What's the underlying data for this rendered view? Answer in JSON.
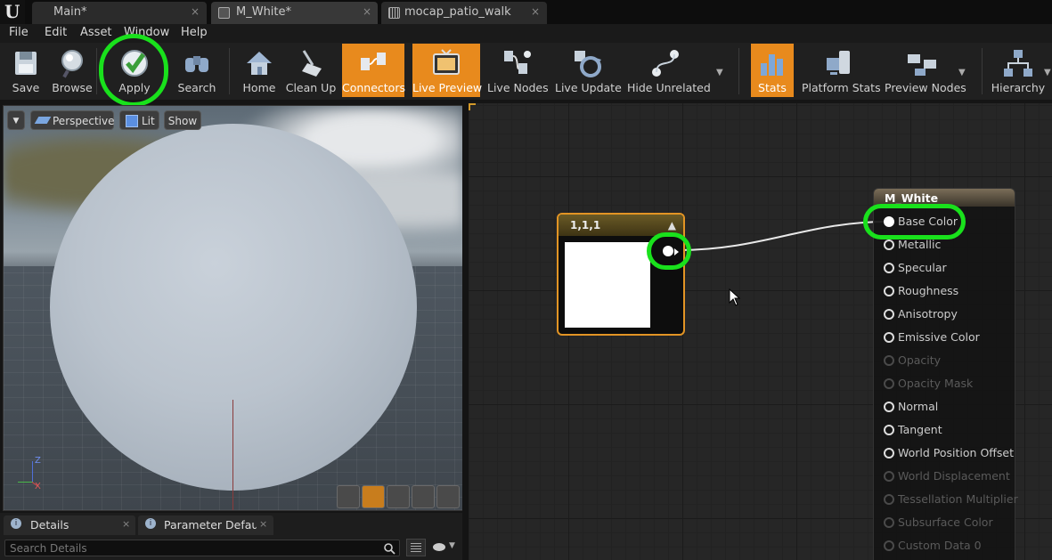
{
  "tabs": [
    {
      "label": "Main*"
    },
    {
      "label": "M_White*"
    },
    {
      "label": "mocap_patio_walk"
    }
  ],
  "tab_close_glyph": "×",
  "logo_text": "U",
  "menu": [
    "File",
    "Edit",
    "Asset",
    "Window",
    "Help"
  ],
  "toolbar": {
    "save": "Save",
    "browse": "Browse",
    "apply": "Apply",
    "search": "Search",
    "home": "Home",
    "clean_up": "Clean Up",
    "connectors": "Connectors",
    "live_preview": "Live Preview",
    "live_nodes": "Live Nodes",
    "live_update": "Live Update",
    "hide_unrelated": "Hide Unrelated",
    "stats": "Stats",
    "platform_stats": "Platform Stats",
    "preview_nodes": "Preview Nodes",
    "hierarchy": "Hierarchy"
  },
  "viewport": {
    "perspective": "Perspective",
    "lit": "Lit",
    "show": "Show",
    "axis_z": "Z",
    "axis_x": "X",
    "axis_y": "Y"
  },
  "details": {
    "tab_details": "Details",
    "tab_params": "Parameter Defaults",
    "search_placeholder": "Search Details"
  },
  "graph": {
    "constant_node": {
      "title": "1,1,1",
      "color": "#ffffff"
    },
    "material_node": {
      "title": "M_White",
      "pins": [
        {
          "label": "Base Color",
          "enabled": true,
          "connected": true
        },
        {
          "label": "Metallic",
          "enabled": true
        },
        {
          "label": "Specular",
          "enabled": true
        },
        {
          "label": "Roughness",
          "enabled": true
        },
        {
          "label": "Anisotropy",
          "enabled": true
        },
        {
          "label": "Emissive Color",
          "enabled": true
        },
        {
          "label": "Opacity",
          "enabled": false
        },
        {
          "label": "Opacity Mask",
          "enabled": false
        },
        {
          "label": "Normal",
          "enabled": true
        },
        {
          "label": "Tangent",
          "enabled": true
        },
        {
          "label": "World Position Offset",
          "enabled": true
        },
        {
          "label": "World Displacement",
          "enabled": false
        },
        {
          "label": "Tessellation Multiplier",
          "enabled": false
        },
        {
          "label": "Subsurface Color",
          "enabled": false
        },
        {
          "label": "Custom Data 0",
          "enabled": false
        }
      ]
    }
  },
  "colors": {
    "highlight": "#19e11c",
    "active_button": "#e88a1d"
  }
}
